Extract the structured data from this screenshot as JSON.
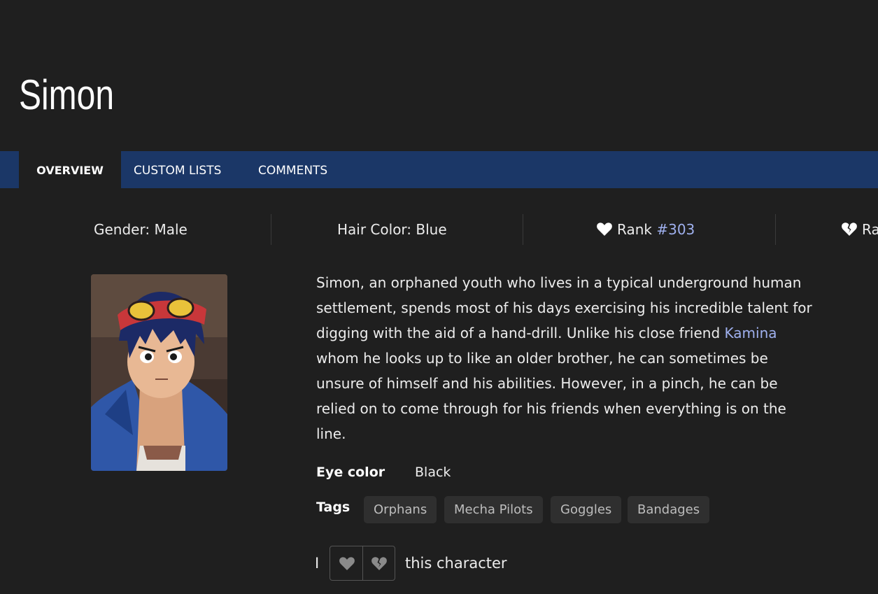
{
  "character": {
    "name": "Simon"
  },
  "tabs": {
    "overview": "OVERVIEW",
    "custom_lists": "CUSTOM LISTS",
    "comments": "COMMENTS"
  },
  "stats": {
    "gender": "Gender: Male",
    "hair_color": "Hair Color: Blue",
    "love_rank_label": "Rank",
    "love_rank_value": "#303",
    "hate_rank_label_visible": "Ra"
  },
  "description": {
    "line1": "Simon, an orphaned youth who lives in a typical underground human",
    "line2": "settlement, spends most of his days exercising his incredible talent for",
    "line3_before": "digging with the aid of a hand-drill. Unlike his close friend ",
    "line3_link": "Kamina",
    "line4": "whom he looks up to like an older brother, he can sometimes be",
    "line5": "unsure of himself and his abilities. However, in a pinch, he can be",
    "line6": "relied on to come through for his friends when everything is on the",
    "line7": "line."
  },
  "attributes": {
    "eye_color_label": "Eye color",
    "eye_color_value": "Black"
  },
  "tags": {
    "label": "Tags",
    "items": [
      "Orphans",
      "Mecha Pilots",
      "Goggles",
      "Bandages"
    ]
  },
  "vote": {
    "prefix": "I",
    "suffix": "this character"
  },
  "colors": {
    "background": "#1f1f1f",
    "tab_bar": "#1b3767",
    "link": "#9fb0ee",
    "tag_bg": "#2f2f2f"
  },
  "icons": [
    "heart-icon",
    "broken-heart-icon"
  ]
}
